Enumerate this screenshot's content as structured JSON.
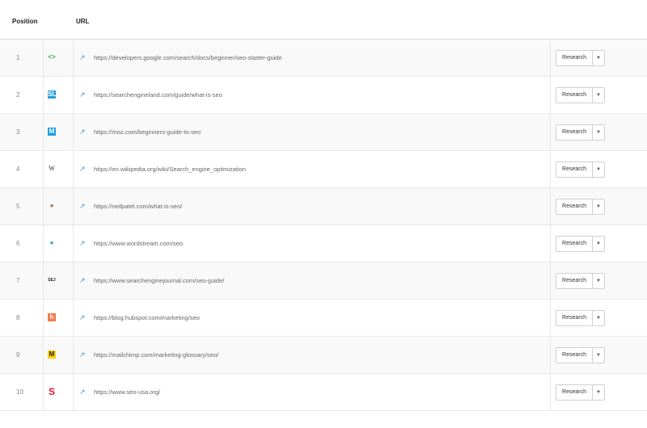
{
  "header": {
    "position_label": "Position",
    "url_label": "URL"
  },
  "rows": [
    {
      "position": "1",
      "favicon": {
        "icon": "google-dev-icon",
        "glyph": "<>",
        "fg": "#34a853",
        "bg": "transparent"
      },
      "url": "https://developers.google.com/search/docs/beginner/seo-starter-guide",
      "button_label": "Research"
    },
    {
      "position": "2",
      "favicon": {
        "icon": "searchengineland-icon",
        "glyph": "SL",
        "fg": "#ffffff",
        "bg": "#2b9fd9"
      },
      "url": "https://searchengineland.com/guide/what-is-seo",
      "button_label": "Research"
    },
    {
      "position": "3",
      "favicon": {
        "icon": "moz-icon",
        "glyph": "M",
        "fg": "#ffffff",
        "bg": "#1c9fe0"
      },
      "url": "https://moz.com/beginners-guide-to-seo",
      "button_label": "Research"
    },
    {
      "position": "4",
      "favicon": {
        "icon": "wikipedia-icon",
        "glyph": "W",
        "fg": "#222222",
        "bg": "transparent"
      },
      "url": "https://en.wikipedia.org/wiki/Search_engine_optimization",
      "button_label": "Research"
    },
    {
      "position": "5",
      "favicon": {
        "icon": "neilpatel-icon",
        "glyph": "●",
        "fg": "#c46a3a",
        "bg": "transparent"
      },
      "url": "https://neilpatel.com/what-is-seo/",
      "button_label": "Research"
    },
    {
      "position": "6",
      "favicon": {
        "icon": "wordstream-icon",
        "glyph": "●",
        "fg": "#27a6c9",
        "bg": "transparent"
      },
      "url": "https://www.wordstream.com/seo",
      "button_label": "Research"
    },
    {
      "position": "7",
      "favicon": {
        "icon": "searchenginejournal-icon",
        "glyph": "SEJ",
        "fg": "#222222",
        "bg": "transparent"
      },
      "url": "https://www.searchenginejournal.com/seo-guide/",
      "button_label": "Research"
    },
    {
      "position": "8",
      "favicon": {
        "icon": "hubspot-icon",
        "glyph": "h",
        "fg": "#ffffff",
        "bg": "#f57a45"
      },
      "url": "https://blog.hubspot.com/marketing/seo",
      "button_label": "Research"
    },
    {
      "position": "9",
      "favicon": {
        "icon": "mailchimp-icon",
        "glyph": "M",
        "fg": "#222222",
        "bg": "#ffd200"
      },
      "url": "https://mailchimp.com/marketing-glossary/seo/",
      "button_label": "Research"
    },
    {
      "position": "10",
      "favicon": {
        "icon": "seo-usa-icon",
        "glyph": "S",
        "fg": "#e0182d",
        "bg": "transparent"
      },
      "url": "https://www.seo-usa.org/",
      "button_label": "Research"
    }
  ],
  "icons": {
    "external_link": "external-link-icon",
    "dropdown": "caret-down-icon"
  },
  "colors": {
    "link_icon": "#4a90d9",
    "row_alt_bg": "#f9f9f9"
  }
}
